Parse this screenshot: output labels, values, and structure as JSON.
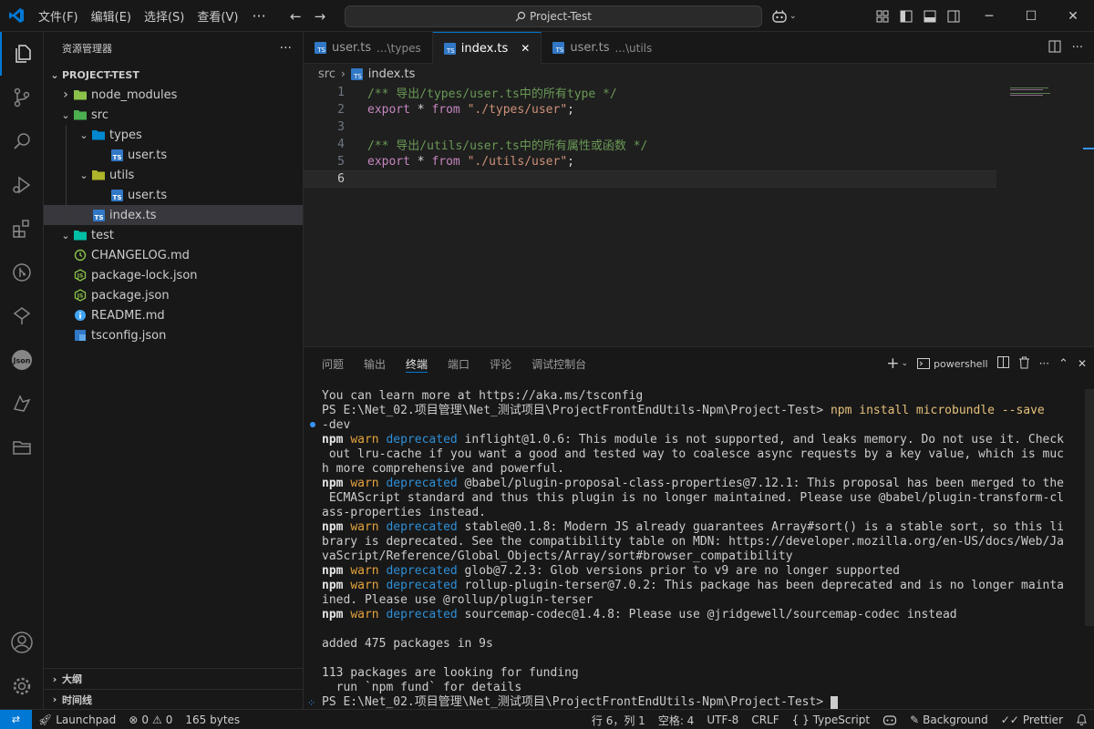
{
  "titlebar": {
    "menus": [
      "文件(F)",
      "编辑(E)",
      "选择(S)",
      "查看(V)"
    ],
    "more": "···",
    "search": "Project-Test"
  },
  "sidebar": {
    "title": "资源管理器",
    "more": "···",
    "root": "PROJECT-TEST",
    "tree": [
      {
        "label": "node_modules",
        "depth": 0,
        "kind": "folder",
        "chevron": "closed",
        "icon_color": "#8bc34a"
      },
      {
        "label": "src",
        "depth": 0,
        "kind": "folder",
        "chevron": "open",
        "icon_color": "#4caf50"
      },
      {
        "label": "types",
        "depth": 1,
        "kind": "folder",
        "chevron": "open",
        "icon_color": "#0288d1"
      },
      {
        "label": "user.ts",
        "depth": 2,
        "kind": "ts"
      },
      {
        "label": "utils",
        "depth": 1,
        "kind": "folder",
        "chevron": "open",
        "icon_color": "#afb42b"
      },
      {
        "label": "user.ts",
        "depth": 2,
        "kind": "ts"
      },
      {
        "label": "index.ts",
        "depth": 1,
        "kind": "ts",
        "selected": true
      },
      {
        "label": "test",
        "depth": 0,
        "kind": "folder",
        "chevron": "open",
        "icon_color": "#00bfa5"
      },
      {
        "label": "CHANGELOG.md",
        "depth": 0,
        "kind": "md"
      },
      {
        "label": "package-lock.json",
        "depth": 0,
        "kind": "node"
      },
      {
        "label": "package.json",
        "depth": 0,
        "kind": "node"
      },
      {
        "label": "README.md",
        "depth": 0,
        "kind": "info"
      },
      {
        "label": "tsconfig.json",
        "depth": 0,
        "kind": "tsconfig"
      }
    ],
    "outline": "大纲",
    "timeline": "时间线"
  },
  "tabs": [
    {
      "label": "user.ts",
      "desc": "...\\types",
      "active": false
    },
    {
      "label": "index.ts",
      "desc": "",
      "active": true
    },
    {
      "label": "user.ts",
      "desc": "...\\utils",
      "active": false
    }
  ],
  "breadcrumb": {
    "folder": "src",
    "file": "index.ts"
  },
  "editor": {
    "current_line": 6,
    "lines": [
      {
        "n": "1",
        "comment": "/** 导出/types/user.ts中的所有type */"
      },
      {
        "n": "2",
        "kw": "export",
        "op": " * ",
        "kw2": "from",
        "str": " \"./types/user\"",
        "end": ";"
      },
      {
        "n": "3"
      },
      {
        "n": "4",
        "comment": "/** 导出/utils/user.ts中的所有属性或函数 */"
      },
      {
        "n": "5",
        "kw": "export",
        "op": " * ",
        "kw2": "from",
        "str": " \"./utils/user\"",
        "end": ";"
      },
      {
        "n": "6"
      }
    ]
  },
  "panel": {
    "tabs": [
      "问题",
      "输出",
      "终端",
      "端口",
      "评论",
      "调试控制台"
    ],
    "active_tab": "终端",
    "shell": "powershell",
    "terminal": [
      "You can learn more at https://aka.ms/tsconfig",
      "PS E:\\Net_02.项目管理\\Net_测试项目\\ProjectFrontEndUtils-Npm\\Project-Test> ",
      "-dev",
      " out lru-cache if you want a good and tested way to coalesce async requests by a key value, which is muc",
      "h more comprehensive and powerful.",
      " ECMAScript standard and thus this plugin is no longer maintained. Please use @babel/plugin-transform-cl",
      "ass-properties instead.",
      "brary is deprecated. See the compatibility table on MDN: https://developer.mozilla.org/en-US/docs/Web/Ja",
      "vaScript/Reference/Global_Objects/Array/sort#browser_compatibility",
      "ined. Please use @rollup/plugin-terser",
      "",
      "added 475 packages in 9s",
      "",
      "113 packages are looking for funding",
      "  run `npm fund` for details",
      "PS E:\\Net_02.项目管理\\Net_测试项目\\ProjectFrontEndUtils-Npm\\Project-Test> "
    ],
    "command": "npm install microbundle --save",
    "npm": "npm",
    "warn": "warn",
    "deprecated": "deprecated",
    "warnings": [
      " inflight@1.0.6: This module is not supported, and leaks memory. Do not use it. Check",
      " @babel/plugin-proposal-class-properties@7.12.1: This proposal has been merged to the",
      " stable@0.1.8: Modern JS already guarantees Array#sort() is a stable sort, so this li",
      " glob@7.2.3: Glob versions prior to v9 are no longer supported",
      " rollup-plugin-terser@7.0.2: This package has been deprecated and is no longer mainta",
      " sourcemap-codec@1.4.8: Please use @jridgewell/sourcemap-codec instead"
    ]
  },
  "statusbar": {
    "launchpad": "Launchpad",
    "errors": "0",
    "warnings": "0",
    "size": "165 bytes",
    "position": "行 6，列 1",
    "spaces": "空格: 4",
    "encoding": "UTF-8",
    "eol": "CRLF",
    "language": "TypeScript",
    "background": "Background",
    "prettier": "Prettier"
  },
  "colors": {
    "accent": "#0078d4",
    "ts": "#3178c6"
  }
}
